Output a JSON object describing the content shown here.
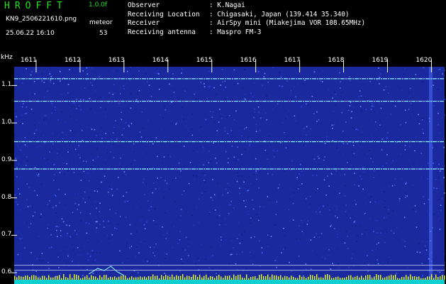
{
  "header": {
    "logo": "HROFFT",
    "version": "1.0.0f",
    "filename": "KN9_2506221610.png",
    "meteor_label": "meteor",
    "datetime": "25.06.22 16:10",
    "meteor_count": "53"
  },
  "info": [
    {
      "key": "Observer",
      "value": ": K.Nagai"
    },
    {
      "key": "Receiving Location",
      "value": ": Chigasaki, Japan (139.414 35.340)"
    },
    {
      "key": "Receiver",
      "value": ": AirSpy mini (Miakejima VOR 108.65MHz)"
    },
    {
      "key": "Receiving antenna",
      "value": ": Maspro FM-3"
    }
  ],
  "chart_data": {
    "type": "heatmap",
    "ylabel": "kHz",
    "x_ticks": [
      "1611",
      "1612",
      "1613",
      "1614",
      "1615",
      "1616",
      "1617",
      "1618",
      "1619",
      "1620"
    ],
    "y_ticks": [
      1.1,
      1.0,
      0.9,
      0.8,
      0.7,
      0.6
    ],
    "ylim": [
      0.57,
      1.15
    ],
    "xlim": [
      1610.5,
      1620.3
    ],
    "horizontal_traces_khz": [
      1.118,
      1.058,
      0.95,
      0.877
    ],
    "colors": {
      "background": "#1a2a9e",
      "trace": "#8ff4ff",
      "grid": "#ffffff",
      "spectrum": "#e8ff20"
    }
  }
}
